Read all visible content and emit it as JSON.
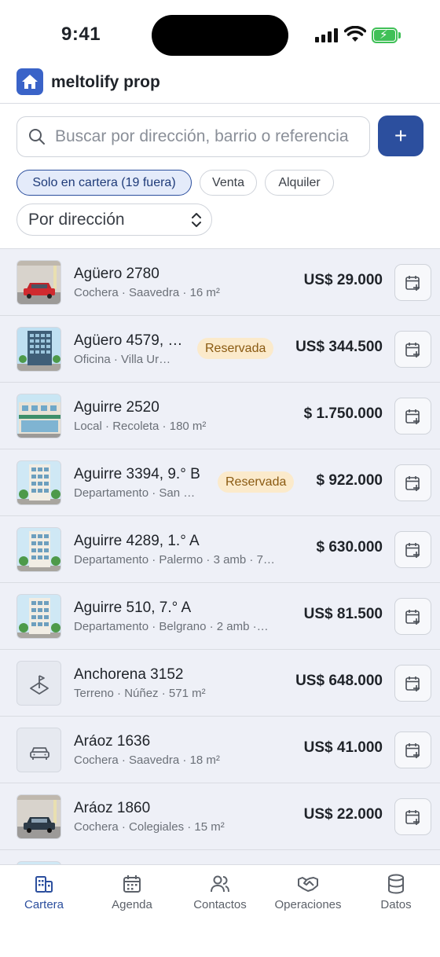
{
  "status_bar": {
    "time": "9:41"
  },
  "header": {
    "title": "meltolify prop",
    "logo_icon": "house-icon",
    "brand_color": "#3a63c8"
  },
  "search": {
    "placeholder": "Buscar por dirección, barrio o referencia",
    "value": "",
    "add_label": "+"
  },
  "filters": [
    {
      "label": "Solo en cartera (19 fuera)",
      "active": true
    },
    {
      "label": "Venta",
      "active": false
    },
    {
      "label": "Alquiler",
      "active": false
    }
  ],
  "sort": {
    "selected": "Por dirección"
  },
  "properties": [
    {
      "title": "Agüero 2780",
      "subtitle": "Cochera · Saavedra · 16 m²",
      "price": "US$ 29.000",
      "badge": "",
      "thumb": "garage-red-car"
    },
    {
      "title": "Agüero 4579, …",
      "subtitle": "Oficina · Villa Ur…",
      "price": "US$ 344.500",
      "badge": "Reservada",
      "thumb": "office-tower"
    },
    {
      "title": "Aguirre 2520",
      "subtitle": "Local · Recoleta · 180 m²",
      "price": "$ 1.750.000",
      "badge": "",
      "thumb": "storefront"
    },
    {
      "title": "Aguirre 3394, 9.° B",
      "subtitle": "Departamento · San …",
      "price": "$ 922.000",
      "badge": "Reservada",
      "thumb": "apartment-building"
    },
    {
      "title": "Aguirre 4289, 1.° A",
      "subtitle": "Departamento · Palermo · 3 amb · 7…",
      "price": "$ 630.000",
      "badge": "",
      "thumb": "apartment-building"
    },
    {
      "title": "Aguirre 510, 7.° A",
      "subtitle": "Departamento · Belgrano · 2 amb ·…",
      "price": "US$ 81.500",
      "badge": "",
      "thumb": "apartment-building"
    },
    {
      "title": "Anchorena 3152",
      "subtitle": "Terreno · Núñez · 571 m²",
      "price": "US$ 648.000",
      "badge": "",
      "thumb": "land-plot-icon"
    },
    {
      "title": "Aráoz 1636",
      "subtitle": "Cochera · Saavedra · 18 m²",
      "price": "US$ 41.000",
      "badge": "",
      "thumb": "car-icon"
    },
    {
      "title": "Aráoz 1860",
      "subtitle": "Cochera · Colegiales · 15 m²",
      "price": "US$ 22.000",
      "badge": "",
      "thumb": "garage-dark-car"
    }
  ],
  "tabs": [
    {
      "label": "Cartera",
      "icon": "building-icon",
      "active": true
    },
    {
      "label": "Agenda",
      "icon": "calendar-icon",
      "active": false
    },
    {
      "label": "Contactos",
      "icon": "people-icon",
      "active": false
    },
    {
      "label": "Operaciones",
      "icon": "handshake-icon",
      "active": false
    },
    {
      "label": "Datos",
      "icon": "database-icon",
      "active": false
    }
  ],
  "colors": {
    "accent": "#2c4f9e",
    "badge_bg": "#fbeacb",
    "badge_text": "#8a5a12",
    "list_bg": "#eef0f7"
  }
}
